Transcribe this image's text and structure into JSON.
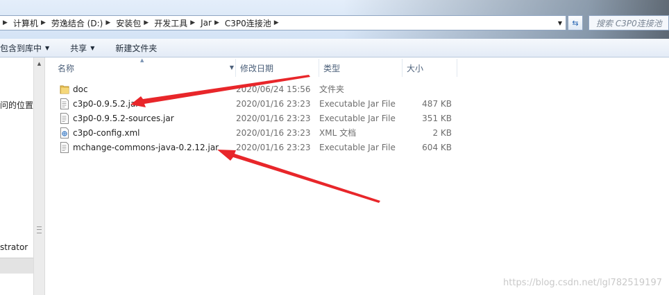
{
  "breadcrumb": [
    "计算机",
    "劳逸结合 (D:)",
    "安装包",
    "开发工具",
    "Jar",
    "C3P0连接池"
  ],
  "search": {
    "placeholder": "搜索 C3P0连接池"
  },
  "toolbar": {
    "include_library": "包含到库中",
    "share": "共享",
    "new_folder": "新建文件夹"
  },
  "nav": {
    "item1": "问的位置",
    "item2": "strator"
  },
  "columns": {
    "name": "名称",
    "date": "修改日期",
    "type": "类型",
    "size": "大小"
  },
  "files": [
    {
      "name": "doc",
      "date": "2020/06/24 15:56",
      "type": "文件夹",
      "size": "",
      "icon": "folder-icon"
    },
    {
      "name": "c3p0-0.9.5.2.jar",
      "date": "2020/01/16 23:23",
      "type": "Executable Jar File",
      "size": "487 KB",
      "icon": "jar-file-icon"
    },
    {
      "name": "c3p0-0.9.5.2-sources.jar",
      "date": "2020/01/16 23:23",
      "type": "Executable Jar File",
      "size": "351 KB",
      "icon": "jar-file-icon"
    },
    {
      "name": "c3p0-config.xml",
      "date": "2020/01/16 23:23",
      "type": "XML 文档",
      "size": "2 KB",
      "icon": "xml-file-icon"
    },
    {
      "name": "mchange-commons-java-0.2.12.jar",
      "date": "2020/01/16 23:23",
      "type": "Executable Jar File",
      "size": "604 KB",
      "icon": "jar-file-icon"
    }
  ],
  "watermark": "https://blog.csdn.net/lgl782519197",
  "colors": {
    "annotation_arrow": "#e8262a",
    "header_text": "#4c607a",
    "address_bar": "#d4e3f5"
  }
}
